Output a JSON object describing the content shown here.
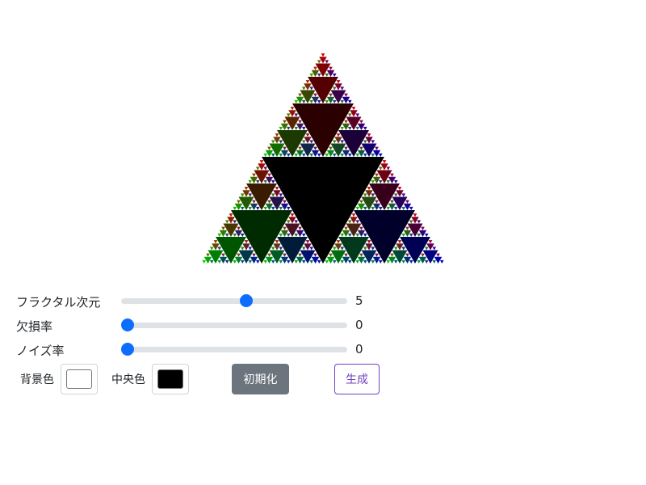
{
  "controls": {
    "dimension": {
      "label": "フラクタル次元",
      "value": "5",
      "min": 0,
      "max": 9
    },
    "loss_rate": {
      "label": "欠損率",
      "value": "0",
      "min": 0,
      "max": 1
    },
    "noise_rate": {
      "label": "ノイズ率",
      "value": "0",
      "min": 0,
      "max": 1
    }
  },
  "colors": {
    "background_label": "背景色",
    "background_value": "#ffffff",
    "center_label": "中央色",
    "center_value": "#000000",
    "corner_colors": [
      "#ff0000",
      "#00ff00",
      "#0000ff"
    ]
  },
  "buttons": {
    "reset_label": "初期化",
    "generate_label": "生成"
  },
  "fractal": {
    "type": "sierpinski-triangle",
    "depth": 5
  }
}
